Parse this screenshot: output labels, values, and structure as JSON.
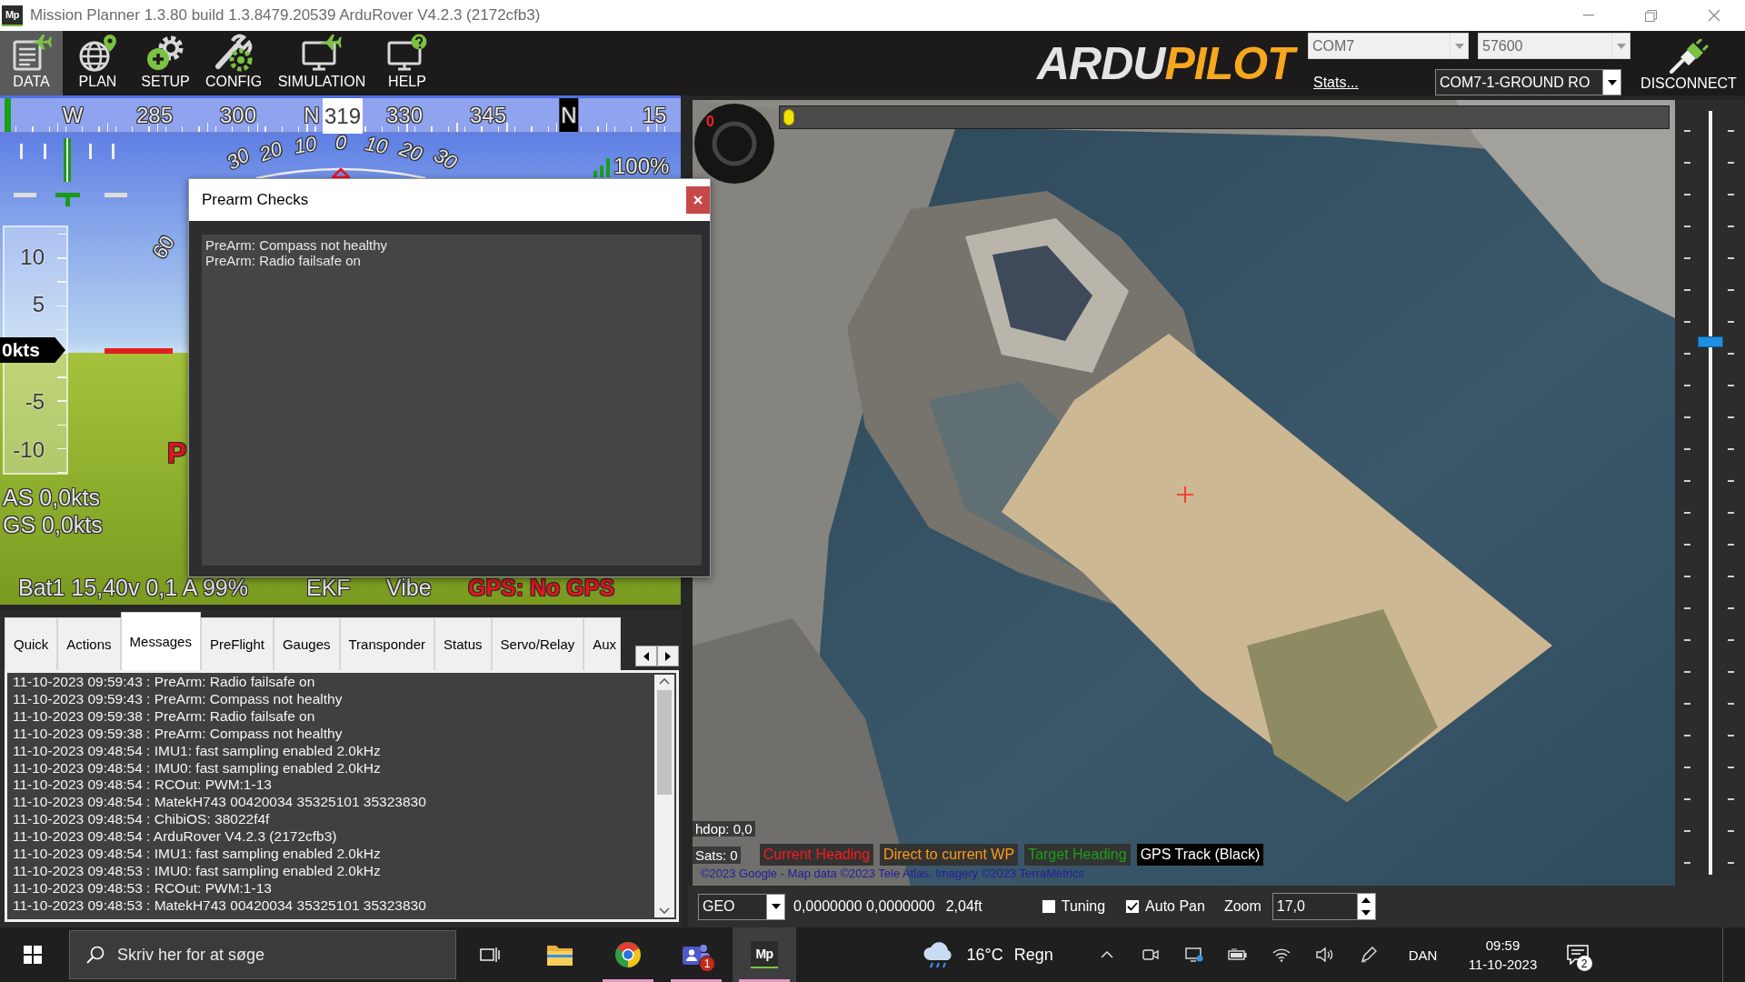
{
  "window": {
    "icon_text": "Mp",
    "title": "Mission Planner 1.3.80 build 1.3.8479.20539 ArduRover V4.2.3 (2172cfb3)"
  },
  "toolbar": {
    "buttons": [
      {
        "kind": "data",
        "label": "DATA",
        "selected": true
      },
      {
        "kind": "plan",
        "label": "PLAN",
        "selected": false
      },
      {
        "kind": "setup",
        "label": "SETUP",
        "selected": false
      },
      {
        "kind": "config",
        "label": "CONFIG",
        "selected": false
      },
      {
        "kind": "simulation",
        "label": "SIMULATION",
        "selected": false
      },
      {
        "kind": "help",
        "label": "HELP",
        "selected": false
      }
    ],
    "logo": {
      "first": "ARDU",
      "second": "PILOT"
    },
    "port": {
      "value": "COM7",
      "disabled": true
    },
    "baud": {
      "value": "57600",
      "disabled": true
    },
    "stats_link": "Stats...",
    "link": {
      "value": "COM7-1-GROUND RO",
      "disabled": false
    },
    "connect_button": "DISCONNECT"
  },
  "hud": {
    "compass": {
      "labels": [
        {
          "text": "W",
          "highlight": false
        },
        {
          "text": "285",
          "highlight": false
        },
        {
          "text": "300",
          "highlight": false
        },
        {
          "text": "N",
          "highlight": false
        },
        {
          "text": "330",
          "highlight": false
        },
        {
          "text": "345",
          "highlight": false
        },
        {
          "text": "N",
          "highlight": true
        },
        {
          "text": "15",
          "highlight": false
        }
      ],
      "heading": "319"
    },
    "roll_labels": [
      "30",
      "20",
      "10",
      "0",
      "10",
      "20",
      "30"
    ],
    "signal": "100%",
    "speed_labels": [
      "10",
      "5",
      "-5",
      "-10"
    ],
    "speed": "0kts",
    "pitch_label": "60",
    "mode_fragment": "P",
    "airspeed": "AS 0,0kts",
    "groundspeed": "GS 0,0kts",
    "status": [
      {
        "text": "Bat1 15,40v 0,1 A 99%",
        "alert": false
      },
      {
        "text": "EKF",
        "alert": false
      },
      {
        "text": "Vibe",
        "alert": false
      },
      {
        "text": "GPS: No GPS",
        "alert": true
      }
    ]
  },
  "dialog": {
    "title": "Prearm Checks",
    "lines": [
      "PreArm: Compass not healthy",
      "PreArm: Radio failsafe on"
    ]
  },
  "tabs": [
    {
      "label": "Quick",
      "selected": false
    },
    {
      "label": "Actions",
      "selected": false
    },
    {
      "label": "Messages",
      "selected": true
    },
    {
      "label": "PreFlight",
      "selected": false
    },
    {
      "label": "Gauges",
      "selected": false
    },
    {
      "label": "Transponder",
      "selected": false
    },
    {
      "label": "Status",
      "selected": false
    },
    {
      "label": "Servo/Relay",
      "selected": false
    },
    {
      "label": "Aux",
      "selected": false
    }
  ],
  "messages": [
    "11-10-2023 09:59:43 : PreArm: Radio failsafe on",
    "11-10-2023 09:59:43 : PreArm: Compass not healthy",
    "11-10-2023 09:59:38 : PreArm: Radio failsafe on",
    "11-10-2023 09:59:38 : PreArm: Compass not healthy",
    "11-10-2023 09:48:54 : IMU1: fast sampling enabled 2.0kHz",
    "11-10-2023 09:48:54 : IMU0: fast sampling enabled 2.0kHz",
    "11-10-2023 09:48:54 : RCOut: PWM:1-13",
    "11-10-2023 09:48:54 : MatekH743 00420034 35325101 35323830",
    "11-10-2023 09:48:54 : ChibiOS: 38022f4f",
    "11-10-2023 09:48:54 : ArduRover V4.2.3 (2172cfb3)",
    "11-10-2023 09:48:54 : IMU1: fast sampling enabled 2.0kHz",
    "11-10-2023 09:48:53 : IMU0: fast sampling enabled 2.0kHz",
    "11-10-2023 09:48:53 : RCOut: PWM:1-13",
    "11-10-2023 09:48:53 : MatekH743 00420034 35325101 35323830"
  ],
  "map": {
    "dial_value": "0",
    "top_slider": {
      "level": 0
    },
    "zoom_slider": {
      "level": 0.7
    },
    "hdop": "hdop: 0,0",
    "sats": "Sats: 0",
    "legend": [
      {
        "text": "Current Heading",
        "kind": "heading"
      },
      {
        "text": "Direct to current WP",
        "kind": "waypoint"
      },
      {
        "text": "Target Heading",
        "kind": "target"
      },
      {
        "text": "GPS Track (Black)",
        "kind": "track"
      }
    ],
    "attribution": "©2023 Google - Map data ©2023 Tele Atlas, Imagery ©2023 TerraMetrics"
  },
  "map_bar": {
    "coord_system": "GEO",
    "position": "0,0000000 0,0000000",
    "altitude": "2,04ft",
    "checkboxes": [
      {
        "label": "Tuning",
        "checked": false
      },
      {
        "label": "Auto Pan",
        "checked": true
      }
    ],
    "zoom_label": "Zoom",
    "zoom_value": "17,0"
  },
  "taskbar": {
    "search_placeholder": "Skriv her for at søge",
    "apps": [
      {
        "kind": "explorer",
        "running": false,
        "active": false
      },
      {
        "kind": "browser",
        "running": true,
        "active": false
      },
      {
        "kind": "chat",
        "running": true,
        "active": false,
        "badge": "1"
      },
      {
        "kind": "planner",
        "running": true,
        "active": true,
        "label": "Mp"
      }
    ],
    "weather": {
      "temperature": "16°C",
      "condition": "Regn"
    },
    "language": "DAN",
    "time": "09:59",
    "date": "11-10-2023",
    "notifications": "2"
  }
}
